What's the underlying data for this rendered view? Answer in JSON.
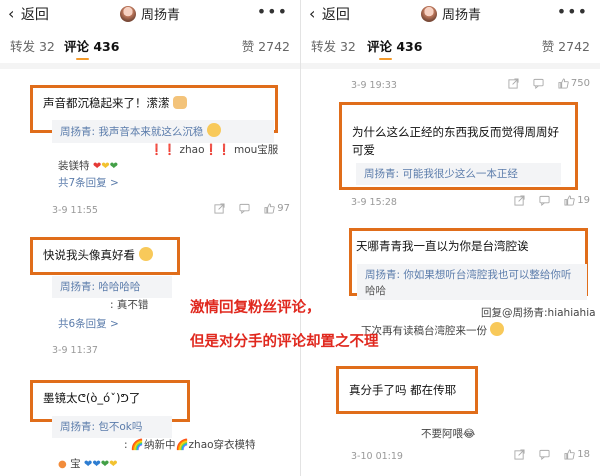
{
  "header": {
    "back_label": "返回",
    "profile_name": "周扬青"
  },
  "tabs": {
    "repost": "转发 32",
    "comment": "评论 436",
    "likes": "赞 2742"
  },
  "overlay": {
    "line1": "激情回复粉丝评论，",
    "line2": "但是对分手的评论却置之不理"
  },
  "left": {
    "c1": {
      "text": "声音都沉稳起来了！潆潆",
      "reply": "周扬青: 我声音本来就这么沉稳",
      "reply2_pre": "❗❗ zhao❗❗ mou宝服",
      "reply2b": "装镁特",
      "more": "共7条回复 >",
      "time": "3-9 11:55",
      "likes": "97"
    },
    "c2": {
      "text": "快说我头像真好看",
      "reply": "周扬青: 哈哈哈哈",
      "reply2": ": 真不错",
      "more": "共6条回复 >",
      "time": "3-9 11:37",
      "likes": ""
    },
    "c3": {
      "text": "墨镜太ᕦ(ò_óˇ)ᕤ了",
      "reply": "周扬青: 包不ok吗",
      "reply2": ": 🌈纳新中🌈zhao穿衣模特",
      "reply3": "宝"
    }
  },
  "right": {
    "top_time": "3-9 19:33",
    "top_likes": "750",
    "c1": {
      "text": "为什么这么正经的东西我反而觉得周周好可爱",
      "reply": "周扬青: 可能我很少这么一本正经",
      "time": "3-9 15:28",
      "likes": "19"
    },
    "c2": {
      "text": "天哪青青我一直以为你是台湾腔诶",
      "reply": "周扬青: 你如果想听台湾腔我也可以整给你听",
      "reply_tail": "哈哈",
      "reply2": "回复@周扬青:hiahiahia",
      "reply3": "下次再有读稿台湾腔来一份"
    },
    "c3": {
      "text": "真分手了吗 都在传耶",
      "reply": "不要阿喂😂",
      "time": "3-10 01:19",
      "likes": "18"
    }
  }
}
